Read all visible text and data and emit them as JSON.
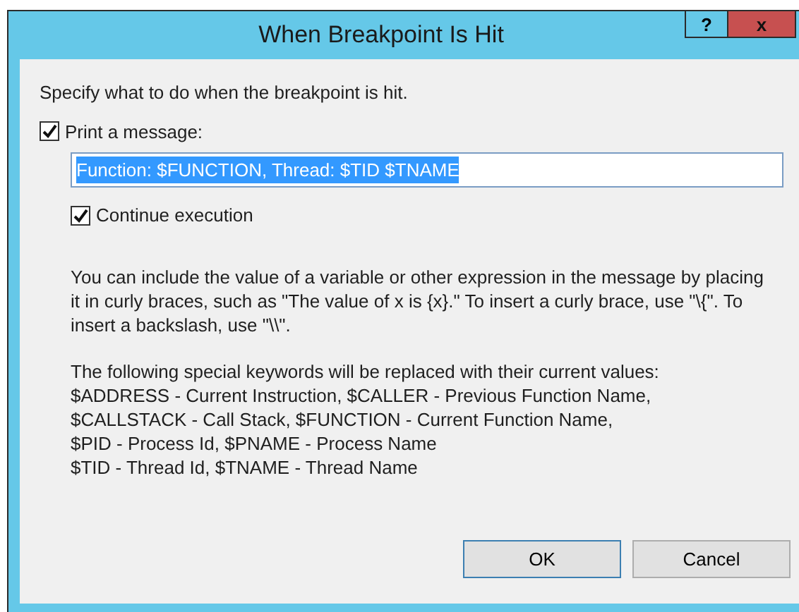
{
  "window": {
    "title": "When Breakpoint Is Hit",
    "help_button": "?",
    "close_button": "x"
  },
  "instruction": "Specify what to do when the breakpoint is hit.",
  "print_message": {
    "label": "Print a message:",
    "checked": true
  },
  "message_field": {
    "value": "Function: $FUNCTION, Thread: $TID $TNAME",
    "selected": true
  },
  "continue_execution": {
    "label": "Continue execution",
    "checked": true
  },
  "help_paragraphs": [
    "You can include the value of a variable or other expression in the message by placing it in curly braces, such as \"The value of x is {x}.\" To insert a curly brace, use \"\\{\". To insert a backslash, use \"\\\\\".",
    "The following special keywords will be replaced with their current values:\n$ADDRESS - Current Instruction, $CALLER - Previous Function Name,\n$CALLSTACK - Call Stack, $FUNCTION - Current Function Name,\n$PID - Process Id, $PNAME - Process Name\n$TID - Thread Id, $TNAME - Thread Name"
  ],
  "buttons": [
    {
      "label": "OK",
      "default": true
    },
    {
      "label": "Cancel",
      "default": false
    }
  ]
}
